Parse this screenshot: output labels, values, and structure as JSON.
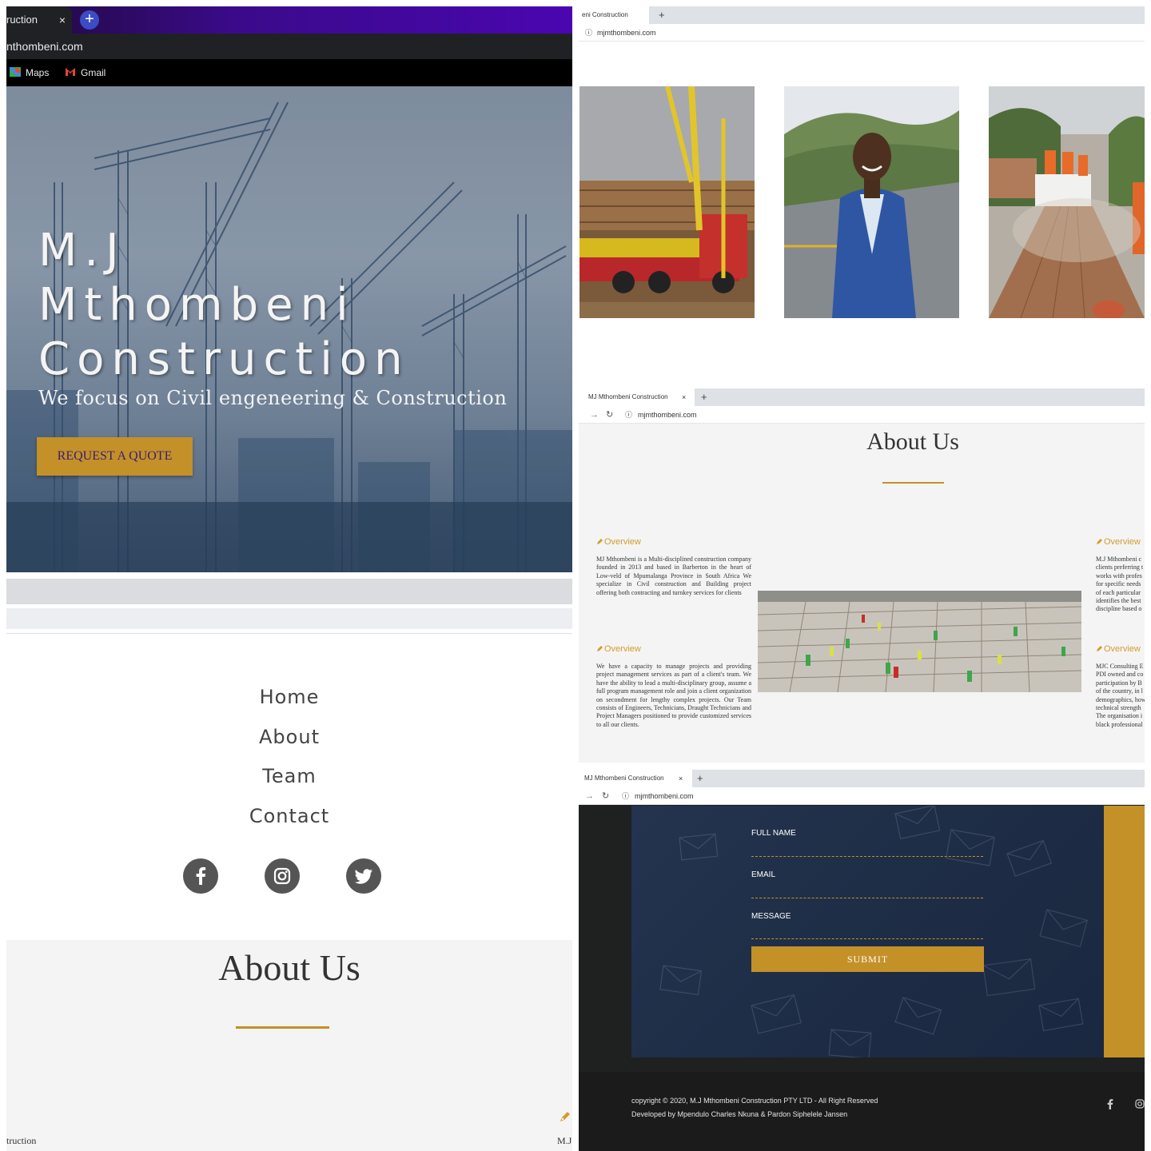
{
  "hero_panel": {
    "tab_label": "ruction",
    "tab_close": "×",
    "new_tab": "+",
    "url": "nthombeni.com",
    "bookmarks": [
      {
        "label": "Maps"
      },
      {
        "label": "Gmail"
      }
    ],
    "title_lines": [
      "M.J",
      "Mthombeni",
      "Construction"
    ],
    "subtitle": "We focus on Civil engeneering & Construction",
    "cta_label": "REQUEST A QUOTE"
  },
  "mobile_panel": {
    "nav_items": [
      "Home",
      "About",
      "Team",
      "Contact"
    ],
    "social_icons": [
      "facebook-icon",
      "instagram-icon",
      "twitter-icon"
    ],
    "about_title": "About Us",
    "fragment_left": "truction",
    "fragment_right": "M.J"
  },
  "photos_panel": {
    "tab_label": "eni Construction",
    "new_tab": "+",
    "url": "mjmthombeni.com"
  },
  "about_panel": {
    "tab_label": "MJ Mthombeni Construction",
    "tab_close": "×",
    "new_tab": "+",
    "url": "mjmthombeni.com",
    "title": "About Us",
    "overview_label": "Overview",
    "paragraphs_left": [
      "MJ Mthombeni is a Multi-disciplined construction company founded in 2013 and based in Barberton in the heart of Low-veld of Mpumalanga Province in South Africa We specialize in Civil construction and Building project offering both contracting and turnkey services for clients",
      "We have a capacity to manage projects and providing project management services as part of a client's team. We have the ability to lead a multi-disciplinary group, assume a full program management role and join a client organization on secondment for lengthy complex projects. Our Team consists of Engineers, Technicians, Draught Technicians and Project Managers positioned to provide customized services to all our clients."
    ],
    "paragraphs_right": [
      [
        "M.J Mthombeni c",
        "clients preferring t",
        "works with profes",
        "for specific needs",
        "of each particular",
        "identifies the best",
        "discipline based o"
      ],
      [
        "MJC Consulting E",
        "PDI owned and co",
        "participation by B",
        "of the country, in l",
        "demographics, how",
        "technical strength",
        "The organisation i",
        "black professional"
      ]
    ]
  },
  "contact_panel": {
    "tab_label": "MJ Mthombeni Construction",
    "tab_close": "×",
    "new_tab": "+",
    "url": "mjmthombeni.com",
    "fields": [
      "FULL NAME",
      "EMAIL",
      "MESSAGE"
    ],
    "submit_label": "SUBMIT",
    "copyright": "copyright © 2020, M.J Mthombeni Construction PTY LTD - All Right Reserved",
    "developed_by": "Developed by Mpendulo Charles Nkuna & Pardon Siphelele Jansen",
    "footer_social": [
      "facebook-icon",
      "instagram-icon"
    ]
  },
  "colors": {
    "accent_gold": "#c39128",
    "navy": "#1d2c44",
    "cta_text": "#3b1d73"
  }
}
